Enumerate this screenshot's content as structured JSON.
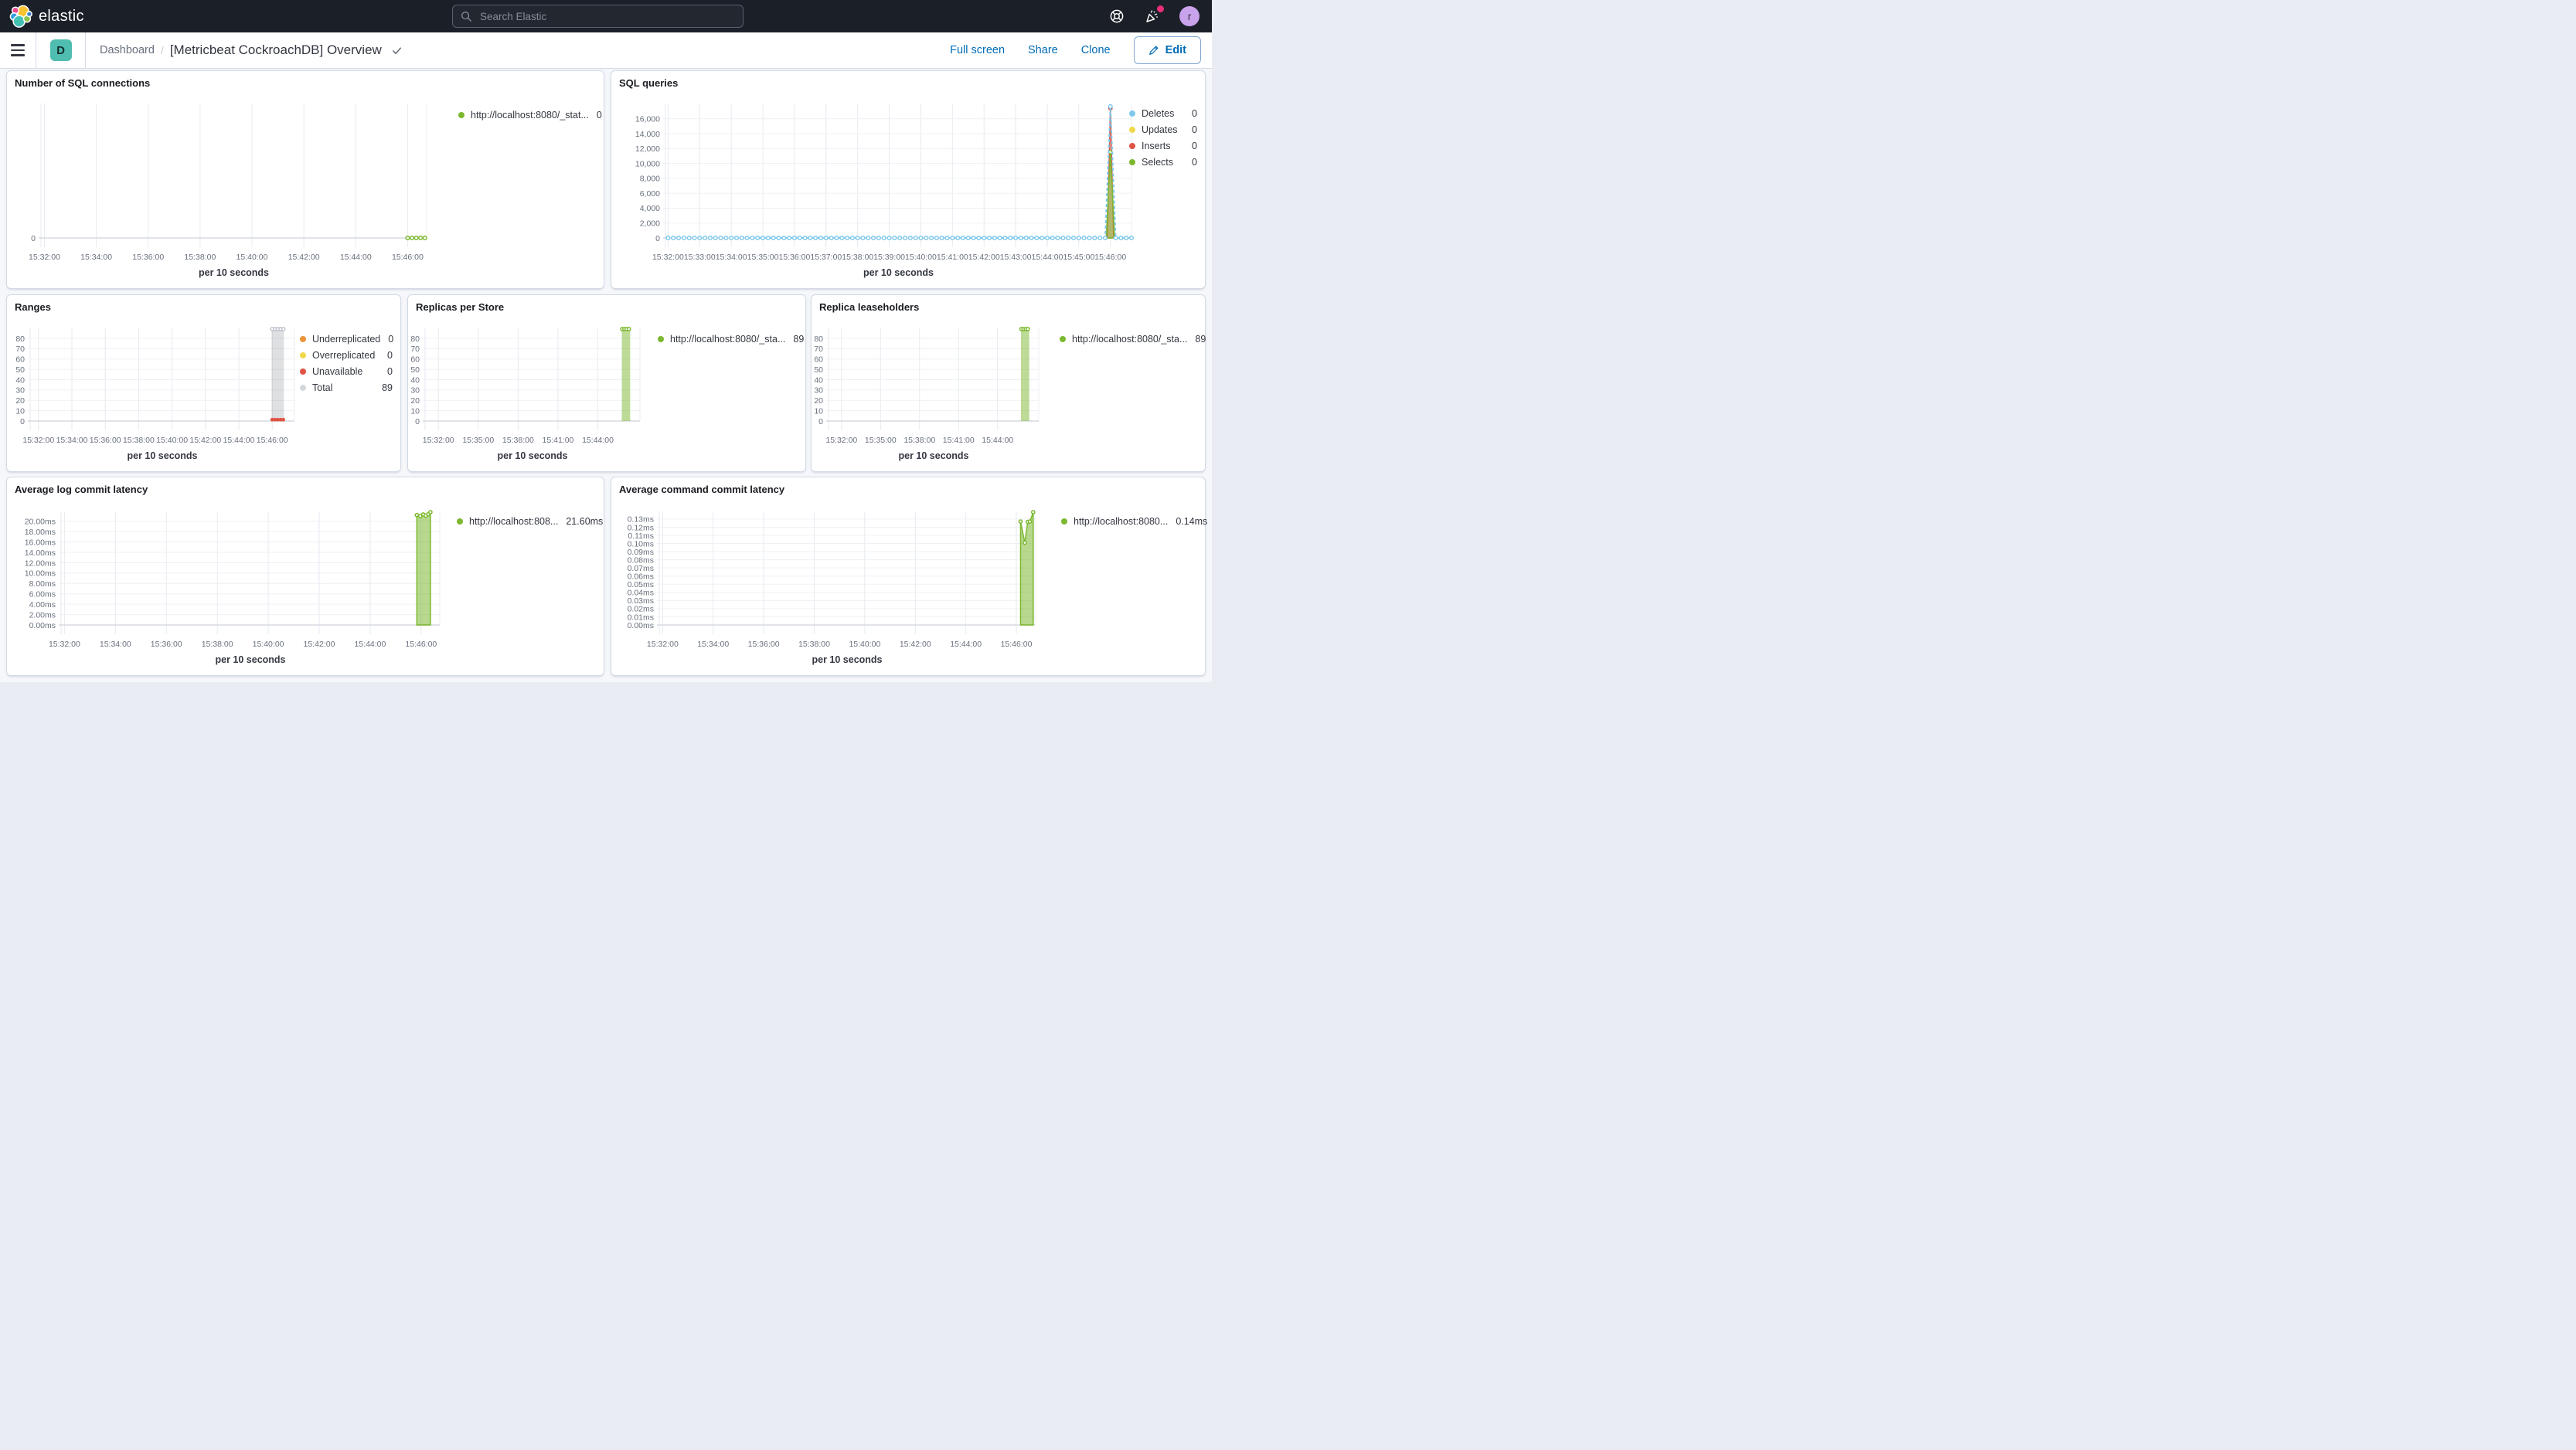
{
  "topbar": {
    "logo": "elastic",
    "search_placeholder": "Search Elastic",
    "avatar": "r"
  },
  "toolbar": {
    "app_badge": "D",
    "breadcrumb_root": "Dashboard",
    "separator": "/",
    "title": "[Metricbeat CockroachDB] Overview",
    "actions": {
      "full_screen": "Full screen",
      "share": "Share",
      "clone": "Clone",
      "edit": "Edit"
    }
  },
  "colors": {
    "green": "#7CB82F",
    "blue": "#7FC9EC",
    "yellow": "#EFD94B",
    "red": "#E05344",
    "orange": "#EB9438",
    "gray": "#D3D7DC",
    "accent_blue": "#006bb4",
    "teal_badge": "#4fbdb0",
    "avatar_purple": "#c9a2ec",
    "notification_pink": "#ec2f74"
  },
  "chart_data": [
    {
      "title": "Number of SQL connections",
      "type": "line",
      "xlabel": "per 10 seconds",
      "x_range": [
        "15:31:52",
        "15:46:44"
      ],
      "x_ticks": [
        "15:32:00",
        "15:34:00",
        "15:36:00",
        "15:38:00",
        "15:40:00",
        "15:42:00",
        "15:44:00",
        "15:46:00"
      ],
      "ylim": [
        0,
        12
      ],
      "y_ticks": [
        {
          "v": 0,
          "label": "0"
        }
      ],
      "series": [
        {
          "name": "http://localhost:8080/_stat...",
          "type": "line",
          "color": "#7CB82F",
          "width": 2,
          "dash": "5,3",
          "marker_step_s": 10,
          "marker_from": "15:46:00",
          "marker_to": "15:46:40",
          "points": [
            [
              "15:46:00",
              0
            ],
            [
              "15:46:40",
              0
            ]
          ]
        }
      ],
      "legend": [
        {
          "label": "http://localhost:8080/_stat...",
          "value": "0",
          "color": "#7CB82F"
        }
      ]
    },
    {
      "title": "SQL queries",
      "type": "line",
      "xlabel": "per 10 seconds",
      "x_range": [
        "15:31:55",
        "15:46:40"
      ],
      "x_ticks": [
        "15:32:00",
        "15:33:00",
        "15:34:00",
        "15:35:00",
        "15:36:00",
        "15:37:00",
        "15:38:00",
        "15:39:00",
        "15:40:00",
        "15:41:00",
        "15:42:00",
        "15:43:00",
        "15:44:00",
        "15:45:00",
        "15:46:00"
      ],
      "ylim": [
        0,
        18050
      ],
      "y_ticks": [
        {
          "v": 0,
          "label": "0"
        },
        {
          "v": 2000,
          "label": "2,000"
        },
        {
          "v": 4000,
          "label": "4,000"
        },
        {
          "v": 6000,
          "label": "6,000"
        },
        {
          "v": 8000,
          "label": "8,000"
        },
        {
          "v": 10000,
          "label": "10,000"
        },
        {
          "v": 12000,
          "label": "12,000"
        },
        {
          "v": 14000,
          "label": "14,000"
        },
        {
          "v": 16000,
          "label": "16,000"
        }
      ],
      "series": [
        {
          "name": "Inserts",
          "type": "area",
          "color": "#E05344",
          "fill": "rgba(224,83,68,0.4)",
          "width": 1.5,
          "marker_at_max": true,
          "points": [
            [
              "15:45:54",
              0
            ],
            [
              "15:46:00",
              17400
            ],
            [
              "15:46:06",
              0
            ]
          ]
        },
        {
          "name": "Selects",
          "type": "area",
          "color": "#7CB82F",
          "fill": "rgba(124,184,47,0.55)",
          "width": 1.5,
          "marker_at_max": true,
          "points": [
            [
              "15:45:52",
              0
            ],
            [
              "15:46:00",
              11530
            ],
            [
              "15:46:08",
              0
            ]
          ]
        },
        {
          "name": "Updates",
          "type": "line",
          "color": "#EFD94B",
          "width": 1.5,
          "points": []
        },
        {
          "name": "Deletes",
          "type": "line",
          "color": "#7FC9EC",
          "width": 2,
          "dash": "4,3",
          "marker_step_s": 10,
          "marker_from": "15:32:00",
          "marker_to": "15:46:40",
          "points": [
            [
              "15:31:55",
              0
            ],
            [
              "15:45:50",
              0
            ],
            [
              "15:46:00",
              17650
            ],
            [
              "15:46:10",
              0
            ],
            [
              "15:46:40",
              0
            ]
          ]
        }
      ],
      "legend": [
        {
          "label": "Deletes",
          "value": "0",
          "color": "#7FC9EC"
        },
        {
          "label": "Updates",
          "value": "0",
          "color": "#EFD94B"
        },
        {
          "label": "Inserts",
          "value": "0",
          "color": "#E05344"
        },
        {
          "label": "Selects",
          "value": "0",
          "color": "#7CB82F"
        }
      ]
    },
    {
      "title": "Ranges",
      "type": "bar",
      "xlabel": "per 10 seconds",
      "x_range": [
        "15:31:30",
        "15:47:20"
      ],
      "x_ticks": [
        "15:32:00",
        "15:34:00",
        "15:36:00",
        "15:38:00",
        "15:40:00",
        "15:42:00",
        "15:44:00",
        "15:46:00"
      ],
      "ylim": [
        0,
        89.7
      ],
      "y_ticks": [
        {
          "v": 0,
          "label": "0"
        },
        {
          "v": 10,
          "label": "10"
        },
        {
          "v": 20,
          "label": "20"
        },
        {
          "v": 30,
          "label": "30"
        },
        {
          "v": 40,
          "label": "40"
        },
        {
          "v": 50,
          "label": "50"
        },
        {
          "v": 60,
          "label": "60"
        },
        {
          "v": 70,
          "label": "70"
        },
        {
          "v": 80,
          "label": "80"
        }
      ],
      "series": [
        {
          "name": "Total",
          "type": "bar",
          "color": "#c3c9d0",
          "fill": "rgba(105,115,125,0.22)",
          "from": "15:45:58",
          "to": "15:46:42",
          "v": 89,
          "top_marker_step_s": 10,
          "marker_color": "#bfc5cc"
        },
        {
          "name": "Unavailable",
          "type": "scatter",
          "color": "#E05344",
          "points": [
            [
              "15:46:00",
              1.3
            ],
            [
              "15:46:10",
              1.3
            ],
            [
              "15:46:20",
              1.3
            ],
            [
              "15:46:30",
              1.3
            ],
            [
              "15:46:40",
              1.3
            ]
          ]
        }
      ],
      "legend": [
        {
          "label": "Underreplicated",
          "value": "0",
          "color": "#EB9438"
        },
        {
          "label": "Overreplicated",
          "value": "0",
          "color": "#EFD94B"
        },
        {
          "label": "Unavailable",
          "value": "0",
          "color": "#E05344"
        },
        {
          "label": "Total",
          "value": "89",
          "color": "#D3D7DC"
        }
      ]
    },
    {
      "title": "Replicas per Store",
      "type": "bar",
      "xlabel": "per 10 seconds",
      "x_range": [
        "15:31:00",
        "15:47:10"
      ],
      "x_ticks": [
        "15:32:00",
        "15:35:00",
        "15:38:00",
        "15:41:00",
        "15:44:00"
      ],
      "ylim": [
        0,
        89.7
      ],
      "y_ticks": [
        {
          "v": 0,
          "label": "0"
        },
        {
          "v": 10,
          "label": "10"
        },
        {
          "v": 20,
          "label": "20"
        },
        {
          "v": 30,
          "label": "30"
        },
        {
          "v": 40,
          "label": "40"
        },
        {
          "v": 50,
          "label": "50"
        },
        {
          "v": 60,
          "label": "60"
        },
        {
          "v": 70,
          "label": "70"
        },
        {
          "v": 80,
          "label": "80"
        }
      ],
      "series": [
        {
          "name": "http://localhost:8080/_sta...",
          "type": "bar",
          "color": "#7CB82F",
          "fill": "rgba(124,184,47,0.5)",
          "from": "15:45:48",
          "to": "15:46:26",
          "v": 89,
          "top_marker_step_s": 10,
          "top_stroke": true
        }
      ],
      "legend": [
        {
          "label": "http://localhost:8080/_sta...",
          "value": "89",
          "color": "#7CB82F"
        }
      ]
    },
    {
      "title": "Replica leaseholders",
      "type": "bar",
      "xlabel": "per 10 seconds",
      "x_range": [
        "15:31:00",
        "15:47:10"
      ],
      "x_ticks": [
        "15:32:00",
        "15:35:00",
        "15:38:00",
        "15:41:00",
        "15:44:00"
      ],
      "ylim": [
        0,
        89.7
      ],
      "y_ticks": [
        {
          "v": 0,
          "label": "0"
        },
        {
          "v": 10,
          "label": "10"
        },
        {
          "v": 20,
          "label": "20"
        },
        {
          "v": 30,
          "label": "30"
        },
        {
          "v": 40,
          "label": "40"
        },
        {
          "v": 50,
          "label": "50"
        },
        {
          "v": 60,
          "label": "60"
        },
        {
          "v": 70,
          "label": "70"
        },
        {
          "v": 80,
          "label": "80"
        }
      ],
      "series": [
        {
          "name": "http://localhost:8080/_sta...",
          "type": "bar",
          "color": "#7CB82F",
          "fill": "rgba(124,184,47,0.5)",
          "from": "15:45:48",
          "to": "15:46:26",
          "v": 89,
          "top_marker_step_s": 10,
          "top_stroke": true
        }
      ],
      "legend": [
        {
          "label": "http://localhost:8080/_sta...",
          "value": "89",
          "color": "#7CB82F"
        }
      ]
    },
    {
      "title": "Average log commit latency",
      "type": "area",
      "xlabel": "per 10 seconds",
      "x_range": [
        "15:31:52",
        "15:46:44"
      ],
      "x_ticks": [
        "15:32:00",
        "15:34:00",
        "15:36:00",
        "15:38:00",
        "15:40:00",
        "15:42:00",
        "15:44:00",
        "15:46:00"
      ],
      "ylim": [
        0,
        21.9
      ],
      "y_ticks": [
        {
          "v": 0,
          "label": "0.00ms"
        },
        {
          "v": 2,
          "label": "2.00ms"
        },
        {
          "v": 4,
          "label": "4.00ms"
        },
        {
          "v": 6,
          "label": "6.00ms"
        },
        {
          "v": 8,
          "label": "8.00ms"
        },
        {
          "v": 10,
          "label": "10.00ms"
        },
        {
          "v": 12,
          "label": "12.00ms"
        },
        {
          "v": 14,
          "label": "14.00ms"
        },
        {
          "v": 16,
          "label": "16.00ms"
        },
        {
          "v": 18,
          "label": "18.00ms"
        },
        {
          "v": 20,
          "label": "20.00ms"
        }
      ],
      "series": [
        {
          "name": "http://localhost:808...",
          "type": "area",
          "color": "#7CB82F",
          "fill": "rgba(124,184,47,0.55)",
          "width": 1.5,
          "markers": "points",
          "points": [
            [
              "15:45:50",
              21.2
            ],
            [
              "15:45:58",
              21.0
            ],
            [
              "15:46:05",
              21.3
            ],
            [
              "15:46:11",
              21.1
            ],
            [
              "15:46:17",
              21.35
            ],
            [
              "15:46:22",
              21.75
            ]
          ]
        }
      ],
      "legend": [
        {
          "label": "http://localhost:808...",
          "value": "21.60ms",
          "color": "#7CB82F"
        }
      ]
    },
    {
      "title": "Average command commit latency",
      "type": "area",
      "xlabel": "per 10 seconds",
      "x_range": [
        "15:31:52",
        "15:46:44"
      ],
      "x_ticks": [
        "15:32:00",
        "15:34:00",
        "15:36:00",
        "15:38:00",
        "15:40:00",
        "15:42:00",
        "15:44:00",
        "15:46:00"
      ],
      "ylim": [
        0,
        0.1394
      ],
      "y_ticks": [
        {
          "v": 0,
          "label": "0.00ms"
        },
        {
          "v": 0.01,
          "label": "0.01ms"
        },
        {
          "v": 0.02,
          "label": "0.02ms"
        },
        {
          "v": 0.03,
          "label": "0.03ms"
        },
        {
          "v": 0.04,
          "label": "0.04ms"
        },
        {
          "v": 0.05,
          "label": "0.05ms"
        },
        {
          "v": 0.06,
          "label": "0.06ms"
        },
        {
          "v": 0.07,
          "label": "0.07ms"
        },
        {
          "v": 0.08,
          "label": "0.08ms"
        },
        {
          "v": 0.09,
          "label": "0.09ms"
        },
        {
          "v": 0.1,
          "label": "0.10ms"
        },
        {
          "v": 0.11,
          "label": "0.11ms"
        },
        {
          "v": 0.12,
          "label": "0.12ms"
        },
        {
          "v": 0.13,
          "label": "0.13ms"
        }
      ],
      "series": [
        {
          "name": "http://localhost:8080...",
          "type": "area",
          "color": "#7CB82F",
          "fill": "rgba(124,184,47,0.55)",
          "width": 1.5,
          "markers": "points",
          "points": [
            [
              "15:46:10",
              0.127
            ],
            [
              "15:46:20",
              0.101
            ],
            [
              "15:46:27",
              0.1265
            ],
            [
              "15:46:32",
              0.127
            ],
            [
              "15:46:40",
              0.1385
            ]
          ]
        }
      ],
      "legend": [
        {
          "label": "http://localhost:8080...",
          "value": "0.14ms",
          "color": "#7CB82F"
        }
      ]
    }
  ]
}
